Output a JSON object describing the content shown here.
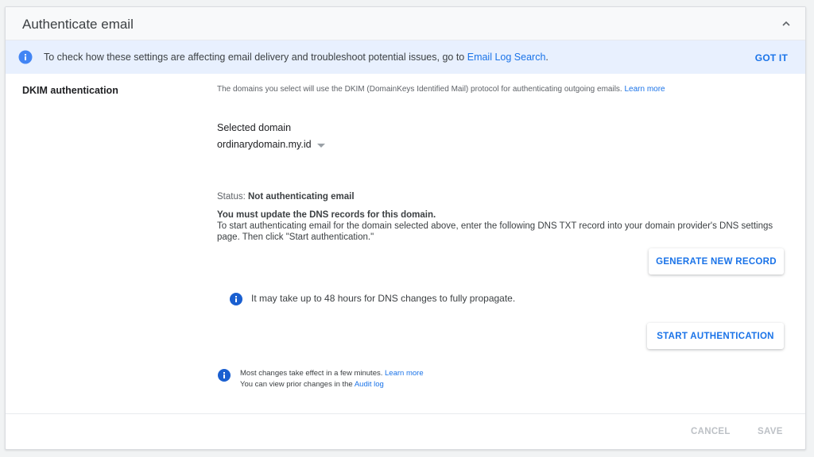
{
  "header": {
    "title": "Authenticate email"
  },
  "banner": {
    "text": "To check how these settings are affecting email delivery and troubleshoot potential issues, go to ",
    "link": "Email Log Search",
    "text_end": ".",
    "action": "GOT IT"
  },
  "dkim": {
    "label": "DKIM authentication",
    "description": "The domains you select will use the DKIM (DomainKeys Identified Mail) protocol for authenticating outgoing emails. ",
    "learn_more": "Learn more",
    "selected_domain_label": "Selected domain",
    "selected_domain_value": "ordinarydomain.my.id",
    "status_label": "Status: ",
    "status_value": "Not authenticating email",
    "must_update": "You must update the DNS records for this domain.",
    "instructions": "To start authenticating email for the domain selected above, enter the following DNS TXT record into your domain provider's DNS settings page. Then click \"Start authentication.\"",
    "generate_button": "GENERATE NEW RECORD",
    "propagate_note": "It may take up to 48 hours for DNS changes to fully propagate.",
    "start_button": "START AUTHENTICATION"
  },
  "changes_note": {
    "line1": "Most changes take effect in a few minutes. ",
    "line1_link": "Learn more",
    "line2": "You can view prior changes in the ",
    "line2_link": "Audit log"
  },
  "footer": {
    "cancel": "CANCEL",
    "save": "SAVE"
  },
  "colors": {
    "accent": "#1a73e8",
    "banner_bg": "#e8f0fe",
    "disabled": "#bdc1c6"
  },
  "icons": {
    "collapse": "chevron-up-icon",
    "info": "info-icon"
  }
}
